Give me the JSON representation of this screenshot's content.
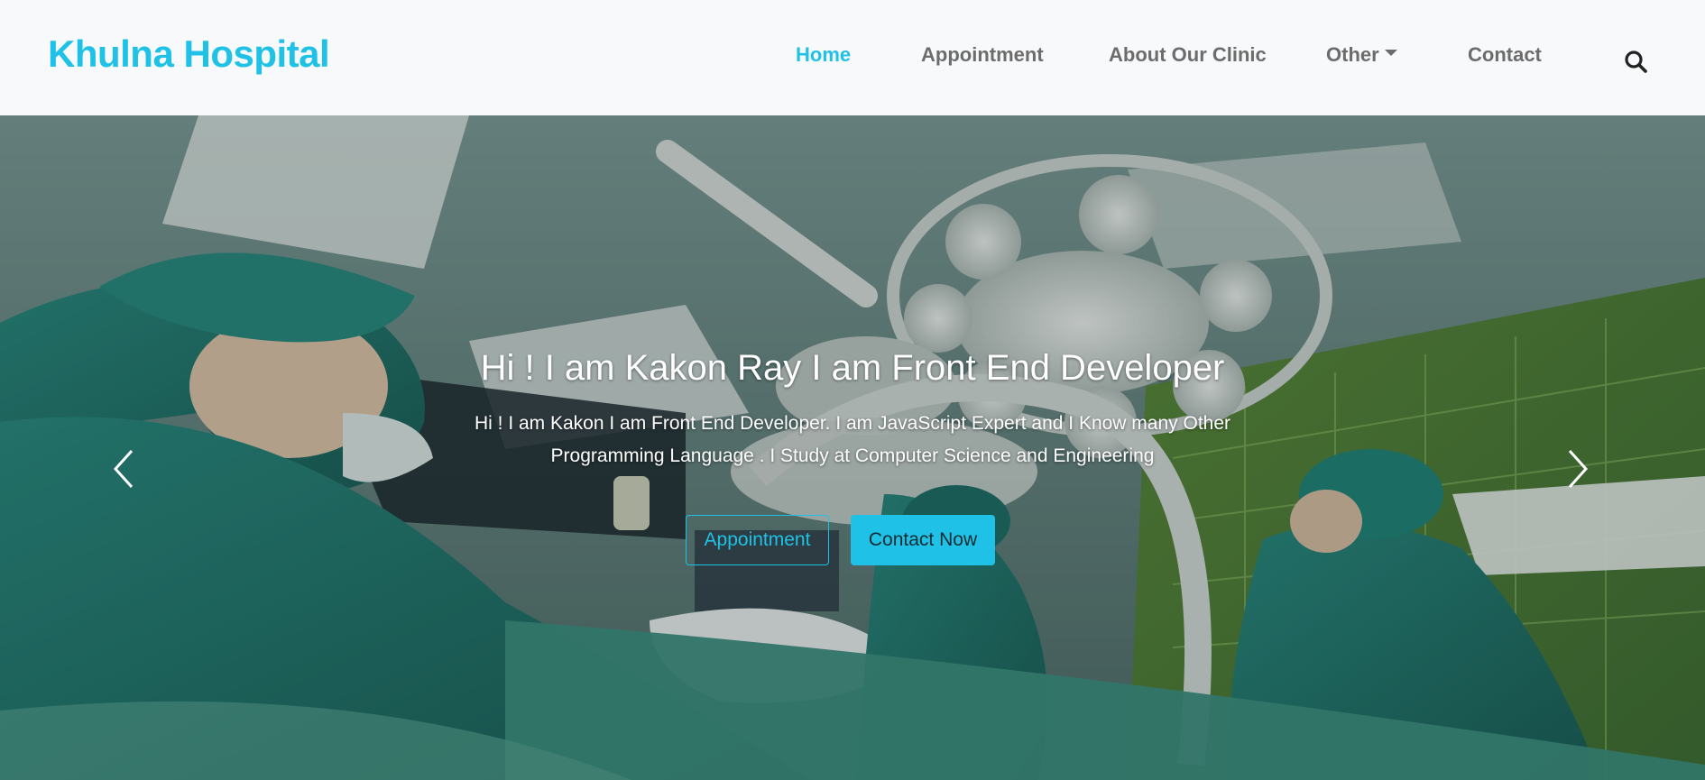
{
  "navbar": {
    "brand": "Khulna Hospital",
    "items": [
      {
        "label": "Home",
        "active": true
      },
      {
        "label": "Appointment",
        "active": false
      },
      {
        "label": "About Our Clinic",
        "active": false
      },
      {
        "label": "Other",
        "active": false,
        "dropdown": true
      },
      {
        "label": "Contact",
        "active": false
      }
    ],
    "search_icon": "search-icon"
  },
  "hero": {
    "title": "Hi ! I am Kakon Ray I am Front End Developer",
    "text": "Hi ! I am Kakon I am Front End Developer. I am JavaScript Expert and I Know many Other Programming Language . I Study at Computer Science and Engineering",
    "primary_button": "Appointment",
    "secondary_button": "Contact Now",
    "prev_icon": "chevron-left-icon",
    "next_icon": "chevron-right-icon"
  },
  "colors": {
    "accent": "#1fc2e6",
    "navbar_bg": "#f8f9fa",
    "nav_text": "#6c6c6c"
  }
}
